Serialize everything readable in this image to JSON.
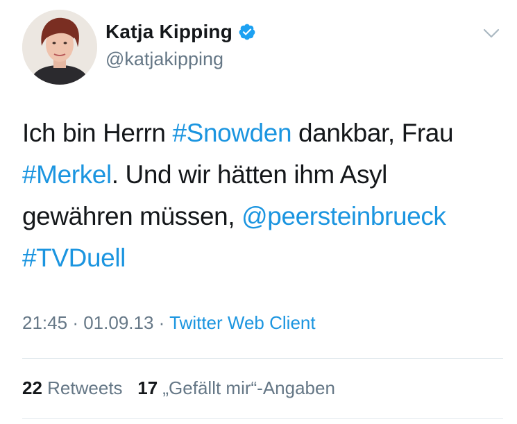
{
  "author": {
    "display_name": "Katja Kipping",
    "handle": "@katjakipping",
    "verified_icon": "verified-badge-icon",
    "avatar_icon": "profile-photo"
  },
  "menu": {
    "icon": "chevron-down-icon"
  },
  "tweet": {
    "segments": [
      {
        "text": "Ich bin Herrn ",
        "link": false
      },
      {
        "text": "#Snowden",
        "link": true
      },
      {
        "text": " dankbar, Frau ",
        "link": false
      },
      {
        "text": "#Merkel",
        "link": true
      },
      {
        "text": ". Und wir hätten ihm Asyl gewähren müssen, ",
        "link": false
      },
      {
        "text": "@peersteinbrueck",
        "link": true
      },
      {
        "text": " ",
        "link": false
      },
      {
        "text": "#TVDuell",
        "link": true
      }
    ]
  },
  "meta": {
    "time": "21:45",
    "separator": "·",
    "date": "01.09.13",
    "source": "Twitter Web Client"
  },
  "stats": {
    "retweets_count": "22",
    "retweets_label": "Retweets",
    "likes_count": "17",
    "likes_label": "„Gefällt mir“-Angaben"
  },
  "colors": {
    "link": "#1b95e0",
    "text": "#14171a",
    "secondary": "#657786",
    "divider": "#e1e8ed"
  }
}
